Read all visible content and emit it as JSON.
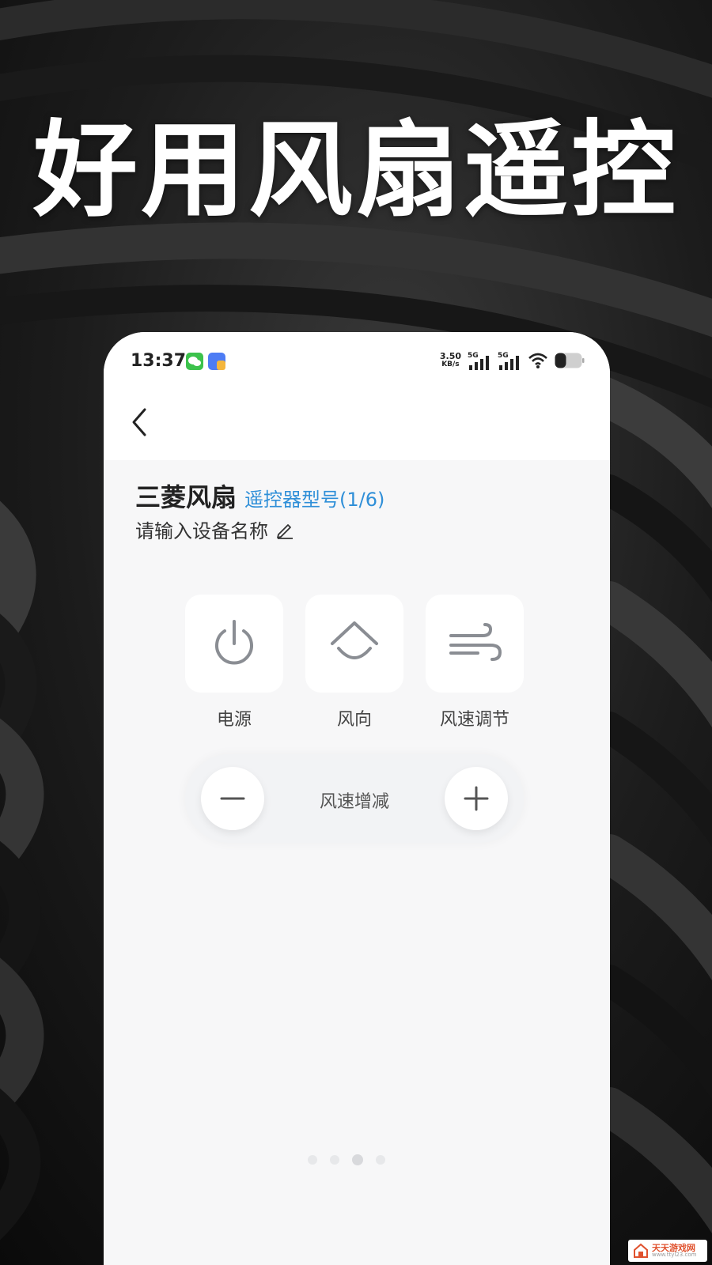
{
  "promo": {
    "headline": "好用风扇遥控"
  },
  "status_bar": {
    "time": "13:37",
    "net_speed_value": "3.50",
    "net_speed_unit": "KB/s",
    "sim1_label": "5G",
    "sim2_label": "5G",
    "icons": [
      "wechat-icon",
      "app-icon",
      "signal-icon",
      "signal-icon",
      "wifi-icon",
      "battery-icon"
    ]
  },
  "header": {
    "back_icon": "chevron-left-icon"
  },
  "device": {
    "name": "三菱风扇",
    "model_label": "遥控器型号(1/6)",
    "rename_placeholder": "请输入设备名称",
    "rename_icon": "pencil-icon"
  },
  "controls": [
    {
      "label": "电源",
      "icon": "power-icon"
    },
    {
      "label": "风向",
      "icon": "wind-direction-icon"
    },
    {
      "label": "风速调节",
      "icon": "wind-speed-icon"
    }
  ],
  "speed_adjust": {
    "label": "风速增减",
    "minus_icon": "minus-icon",
    "plus_icon": "plus-icon"
  },
  "pagination": {
    "count": 4,
    "active_index": 2
  },
  "watermark": {
    "title": "天天游戏网",
    "url": "www.ttyl23.com"
  },
  "colors": {
    "accent": "#2f8fd8",
    "page_bg": "#f7f7f8",
    "icon_gray": "#8a8d93",
    "headline": "#ffffff"
  }
}
